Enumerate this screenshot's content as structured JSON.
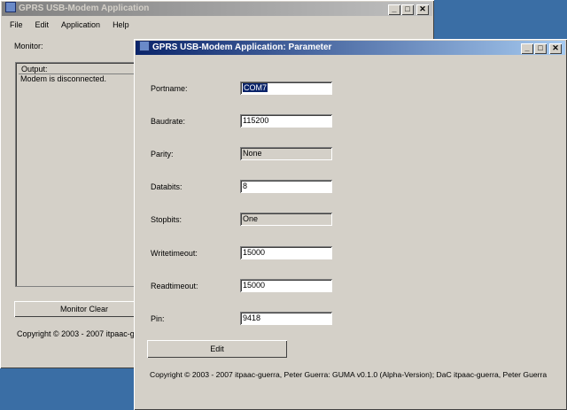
{
  "main_window": {
    "title": "GPRS USB-Modem Application",
    "menu": [
      "File",
      "Edit",
      "Application",
      "Help"
    ],
    "monitor_label": "Monitor:",
    "output_header": "Output:",
    "output_lines": [
      "Modem is disconnected."
    ],
    "monitor_clear_label": "Monitor Clear",
    "copyright": "Copyright © 2003 - 2007 itpaac-g"
  },
  "param_window": {
    "title": "GPRS USB-Modem Application: Parameter",
    "fields": [
      {
        "label": "Portname:",
        "value": "COM7",
        "editable": true,
        "selected": true
      },
      {
        "label": "Baudrate:",
        "value": "115200",
        "editable": true,
        "selected": false
      },
      {
        "label": "Parity:",
        "value": "None",
        "editable": false,
        "selected": false
      },
      {
        "label": "Databits:",
        "value": "8",
        "editable": true,
        "selected": false
      },
      {
        "label": "Stopbits:",
        "value": "One",
        "editable": false,
        "selected": false
      },
      {
        "label": "Writetimeout:",
        "value": "15000",
        "editable": true,
        "selected": false
      },
      {
        "label": "Readtimeout:",
        "value": "15000",
        "editable": true,
        "selected": false
      },
      {
        "label": "Pin:",
        "value": "9418",
        "editable": true,
        "selected": false
      }
    ],
    "edit_label": "Edit",
    "copyright": "Copyright © 2003 - 2007 itpaac-guerra, Peter Guerra: GUMA v0.1.0 (Alpha-Version); DaC itpaac-guerra, Peter Guerra"
  },
  "window_buttons": {
    "minimize": "_",
    "maximize": "□",
    "close": "✕"
  },
  "colors": {
    "desktop": "#3a6ea5",
    "active_title": "#0a246a",
    "inactive_title": "#808080",
    "face": "#d4d0c8"
  }
}
